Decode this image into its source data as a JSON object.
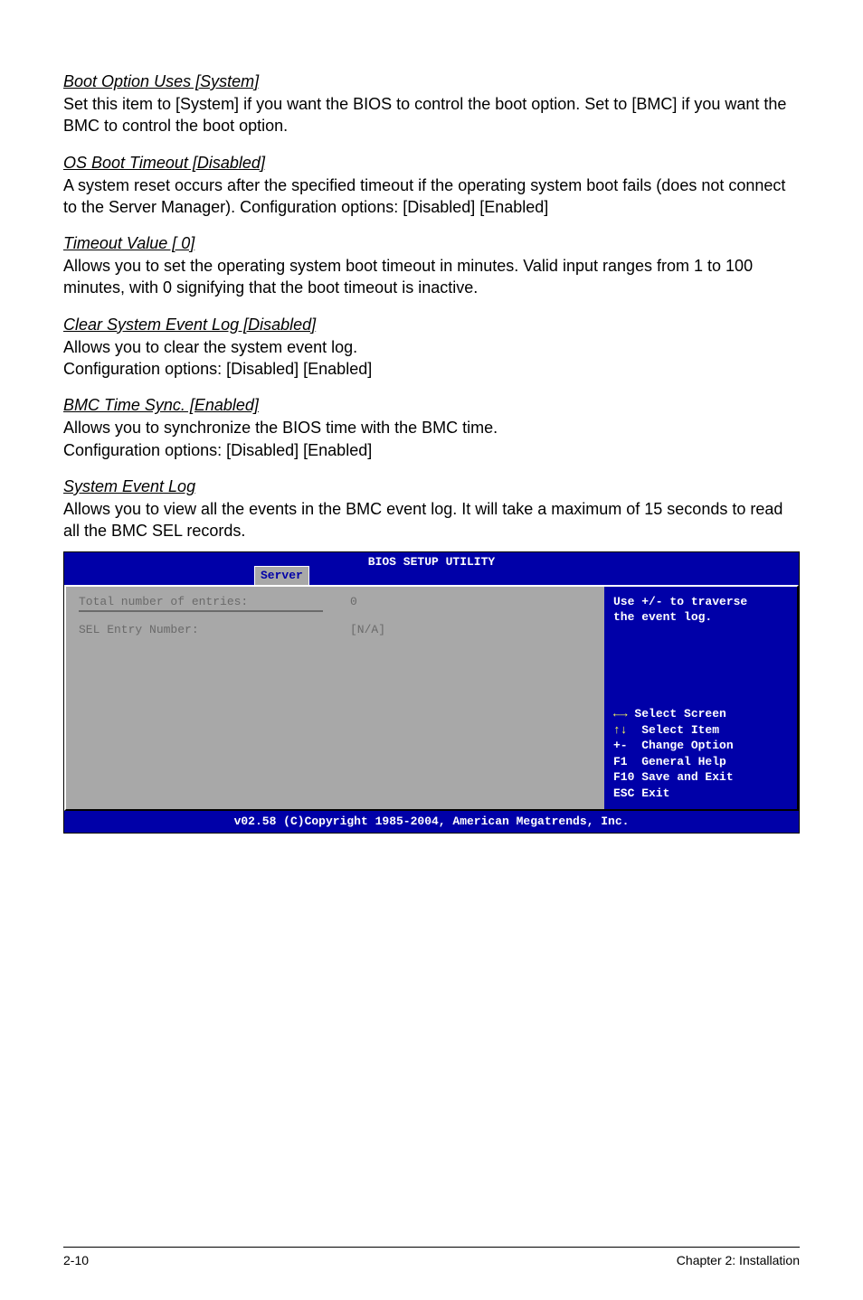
{
  "sections": [
    {
      "heading": "Boot Option Uses [System]",
      "body": "Set this item to [System] if you want the BIOS to control the boot option. Set to [BMC] if you want the BMC to control the boot option."
    },
    {
      "heading": "OS Boot Timeout [Disabled]",
      "body": "A system reset occurs after the specified timeout if the operating system boot fails (does not connect to the Server Manager). Configuration options: [Disabled] [Enabled]"
    },
    {
      "heading": "Timeout Value [  0]",
      "body": "Allows you to set the operating system boot timeout in minutes. Valid input ranges from 1 to 100 minutes, with 0 signifying that the boot timeout is inactive."
    },
    {
      "heading": "Clear System Event Log [Disabled]",
      "body": "Allows you to clear the system event log.\nConfiguration options: [Disabled] [Enabled]"
    },
    {
      "heading": "BMC Time Sync. [Enabled]",
      "body": "Allows you to synchronize the BIOS time with the BMC time.\nConfiguration options: [Disabled] [Enabled]"
    },
    {
      "heading": "System Event Log",
      "body": "Allows you to view all the events in the BMC event log. It will take a maximum of 15 seconds to read all the BMC SEL records."
    }
  ],
  "bios": {
    "title": "BIOS SETUP UTILITY",
    "tab": "Server",
    "rows": [
      {
        "label": "Total number of entries:",
        "value": "0"
      },
      {
        "label": "SEL Entry Number:",
        "value": "[N/A]"
      }
    ],
    "help_top": "Use +/- to traverse\nthe event log.",
    "help_nav": {
      "select_screen": "Select Screen",
      "select_item": "Select Item",
      "change_option": "+-  Change Option",
      "general_help": "F1  General Help",
      "save_exit": "F10 Save and Exit",
      "esc_exit": "ESC Exit"
    },
    "footer": "v02.58 (C)Copyright 1985-2004, American Megatrends, Inc."
  },
  "page_footer": {
    "left": "2-10",
    "right": "Chapter 2: Installation"
  }
}
